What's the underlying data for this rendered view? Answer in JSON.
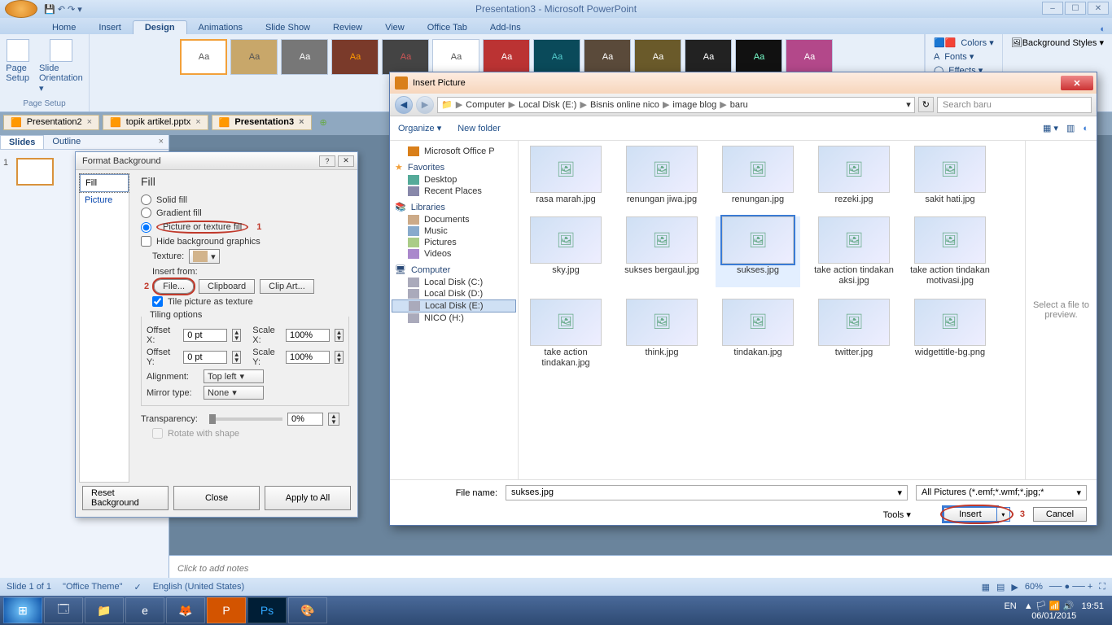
{
  "window": {
    "title": "Presentation3 - Microsoft PowerPoint",
    "controls": {
      "min": "–",
      "max": "☐",
      "close": "✕"
    }
  },
  "ribbon": {
    "tabs": [
      "Home",
      "Insert",
      "Design",
      "Animations",
      "Slide Show",
      "Review",
      "View",
      "Office Tab",
      "Add-Ins"
    ],
    "active_index": 2,
    "page_setup": {
      "page_setup": "Page Setup",
      "slide_orientation": "Slide Orientation ▾",
      "group": "Page Setup"
    },
    "themes_aa": "Aa",
    "colors": "Colors ▾",
    "fonts": "Fonts ▾",
    "effects": "Effects ▾",
    "bg_styles": "Background Styles ▾"
  },
  "doc_tabs": [
    {
      "label": "Presentation2",
      "close": "×"
    },
    {
      "label": "topik artikel.pptx",
      "close": "×"
    },
    {
      "label": "Presentation3",
      "close": "×",
      "active": true
    }
  ],
  "left_panel": {
    "tabs": [
      "Slides",
      "Outline"
    ],
    "close": "×"
  },
  "notes_placeholder": "Click to add notes",
  "statusbar": {
    "slide": "Slide 1 of 1",
    "theme": "\"Office Theme\"",
    "lang": "English (United States)",
    "zoom": "60%"
  },
  "taskbar": {
    "lang": "EN",
    "time": "19:51",
    "date": "06/01/2015"
  },
  "format_bg": {
    "title": "Format Background",
    "side": [
      "Fill",
      "Picture"
    ],
    "heading": "Fill",
    "solid": "Solid fill",
    "gradient": "Gradient fill",
    "picture_texture": "Picture or texture fill",
    "hide_bg": "Hide background graphics",
    "texture_label": "Texture:",
    "insert_from": "Insert from:",
    "file_btn": "File...",
    "clipboard_btn": "Clipboard",
    "clipart_btn": "Clip Art...",
    "tile_check": "Tile picture as texture",
    "tiling_legend": "Tiling options",
    "offset_x": "Offset X:",
    "offset_y": "Offset Y:",
    "scale_x": "Scale X:",
    "scale_y": "Scale Y:",
    "offset_x_val": "0 pt",
    "offset_y_val": "0 pt",
    "scale_x_val": "100%",
    "scale_y_val": "100%",
    "alignment": "Alignment:",
    "alignment_val": "Top left",
    "mirror": "Mirror type:",
    "mirror_val": "None",
    "transparency": "Transparency:",
    "transparency_val": "0%",
    "rotate": "Rotate with shape",
    "reset": "Reset Background",
    "close": "Close",
    "apply_all": "Apply to All",
    "mark1": "1",
    "mark2": "2"
  },
  "insert_pic": {
    "title": "Insert Picture",
    "breadcrumbs": [
      "Computer",
      "Local Disk (E:)",
      "Bisnis online nico",
      "image blog",
      "baru"
    ],
    "search_ph": "Search baru",
    "organize": "Organize ▾",
    "new_folder": "New folder",
    "side": {
      "office_header": "Microsoft Office P",
      "favorites": "Favorites",
      "desktop": "Desktop",
      "recent": "Recent Places",
      "libraries": "Libraries",
      "documents": "Documents",
      "music": "Music",
      "pictures": "Pictures",
      "videos": "Videos",
      "computer": "Computer",
      "disk_c": "Local Disk (C:)",
      "disk_d": "Local Disk (D:)",
      "disk_e": "Local Disk (E:)",
      "disk_h": "NICO (H:)"
    },
    "files": [
      "rasa marah.jpg",
      "renungan jiwa.jpg",
      "renungan.jpg",
      "rezeki.jpg",
      "sakit hati.jpg",
      "sky.jpg",
      "sukses bergaul.jpg",
      "sukses.jpg",
      "take action tindakan aksi.jpg",
      "take action tindakan motivasi.jpg",
      "take action tindakan.jpg",
      "think.jpg",
      "tindakan.jpg",
      "twitter.jpg",
      "widgettitle-bg.png"
    ],
    "selected_index": 7,
    "preview_text": "Select a file to preview.",
    "file_name_label": "File name:",
    "file_name_val": "sukses.jpg",
    "filter": "All Pictures (*.emf;*.wmf;*.jpg;*",
    "tools": "Tools ▾",
    "insert": "Insert",
    "cancel": "Cancel",
    "mark3": "3"
  }
}
